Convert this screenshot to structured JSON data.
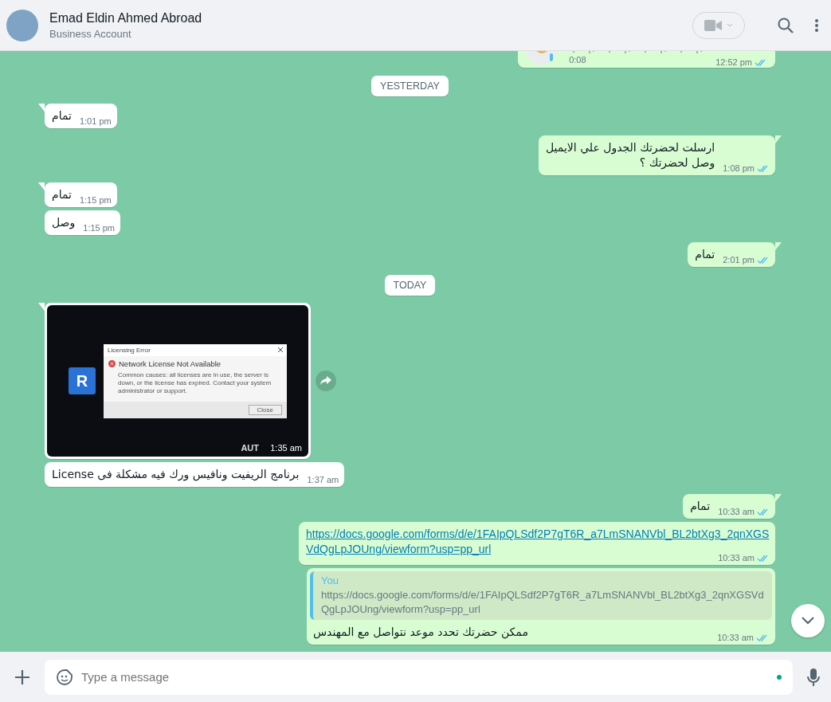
{
  "header": {
    "name": "Emad Eldin Ahmed Abroad",
    "subtitle": "Business Account"
  },
  "messages": [
    {
      "kind": "voice",
      "outgoing": true,
      "tail": false,
      "duration": "0:08",
      "time": "12:52 pm",
      "read": true
    },
    {
      "kind": "date",
      "label": "YESTERDAY"
    },
    {
      "kind": "text",
      "outgoing": false,
      "tail": true,
      "text": "تمام",
      "time": "1:01 pm"
    },
    {
      "kind": "text",
      "outgoing": true,
      "tail": true,
      "text": "ارسلت لحضرتك الجدول علي الايميل\nوصل لحضرتك ؟",
      "time": "1:08 pm",
      "read": true
    },
    {
      "kind": "text",
      "outgoing": false,
      "tail": true,
      "text": "تمام",
      "time": "1:15 pm"
    },
    {
      "kind": "text",
      "outgoing": false,
      "tail": false,
      "text": "وصل",
      "time": "1:15 pm"
    },
    {
      "kind": "text",
      "outgoing": true,
      "tail": true,
      "text": "تمام",
      "time": "2:01 pm",
      "read": true
    },
    {
      "kind": "date",
      "label": "TODAY"
    },
    {
      "kind": "image",
      "outgoing": false,
      "tail": true,
      "time": "1:35 am",
      "dialog": {
        "title": "Licensing Error",
        "heading": "Network License Not Available",
        "body": "Common causes: all licenses are in use, the server is down, or the license has expired. Contact your system administrator or support.",
        "button": "Close"
      },
      "logo_letter": "R",
      "brand_text": "AUT"
    },
    {
      "kind": "text",
      "outgoing": false,
      "tail": false,
      "text": "برنامج الريفيت ونافيس ورك فيه مشكلة فى License",
      "time": "1:37 am"
    },
    {
      "kind": "text",
      "outgoing": true,
      "tail": true,
      "text": "تمام",
      "time": "10:33 am",
      "read": true
    },
    {
      "kind": "link",
      "outgoing": true,
      "tail": false,
      "url": "https://docs.google.com/forms/d/e/1FAIpQLSdf2P7gT6R_a7LmSNANVbl_BL2btXg3_2qnXGSVdQgLpJOUng/viewform?usp=pp_url",
      "time": "10:33 am",
      "read": true
    },
    {
      "kind": "reply",
      "outgoing": true,
      "tail": false,
      "quote_author": "You",
      "quote_text": "https://docs.google.com/forms/d/e/1FAIpQLSdf2P7gT6R_a7LmSNANVbl_BL2btXg3_2qnXGSVdQgLpJOUng/viewform?usp=pp_url",
      "text": "ممكن حضرتك تحدد موعد نتواصل مع المهندس",
      "time": "10:33 am",
      "read": true
    }
  ],
  "composer": {
    "placeholder": "Type a message"
  }
}
